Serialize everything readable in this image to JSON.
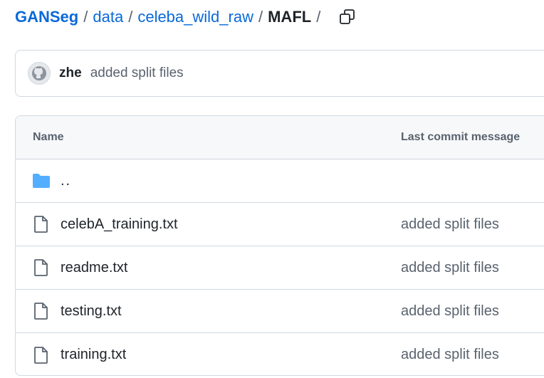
{
  "breadcrumb": {
    "repo": "GANSeg",
    "separator": "/",
    "segments": [
      "data",
      "celeba_wild_raw"
    ],
    "current": "MAFL",
    "trailing_sep": "/"
  },
  "latest_commit": {
    "author": "zhe",
    "message": "added split files"
  },
  "table": {
    "headers": {
      "name": "Name",
      "last_commit": "Last commit message"
    },
    "parent_dir": "..",
    "rows": [
      {
        "name": "celebA_training.txt",
        "message": "added split files",
        "icon": "file-icon"
      },
      {
        "name": "readme.txt",
        "message": "added split files",
        "icon": "file-icon"
      },
      {
        "name": "testing.txt",
        "message": "added split files",
        "icon": "file-icon"
      },
      {
        "name": "training.txt",
        "message": "added split files",
        "icon": "file-icon"
      }
    ]
  },
  "colors": {
    "link": "#0969da",
    "folder": "#54aeff",
    "muted": "#59636e",
    "border": "#d1d9e0"
  }
}
